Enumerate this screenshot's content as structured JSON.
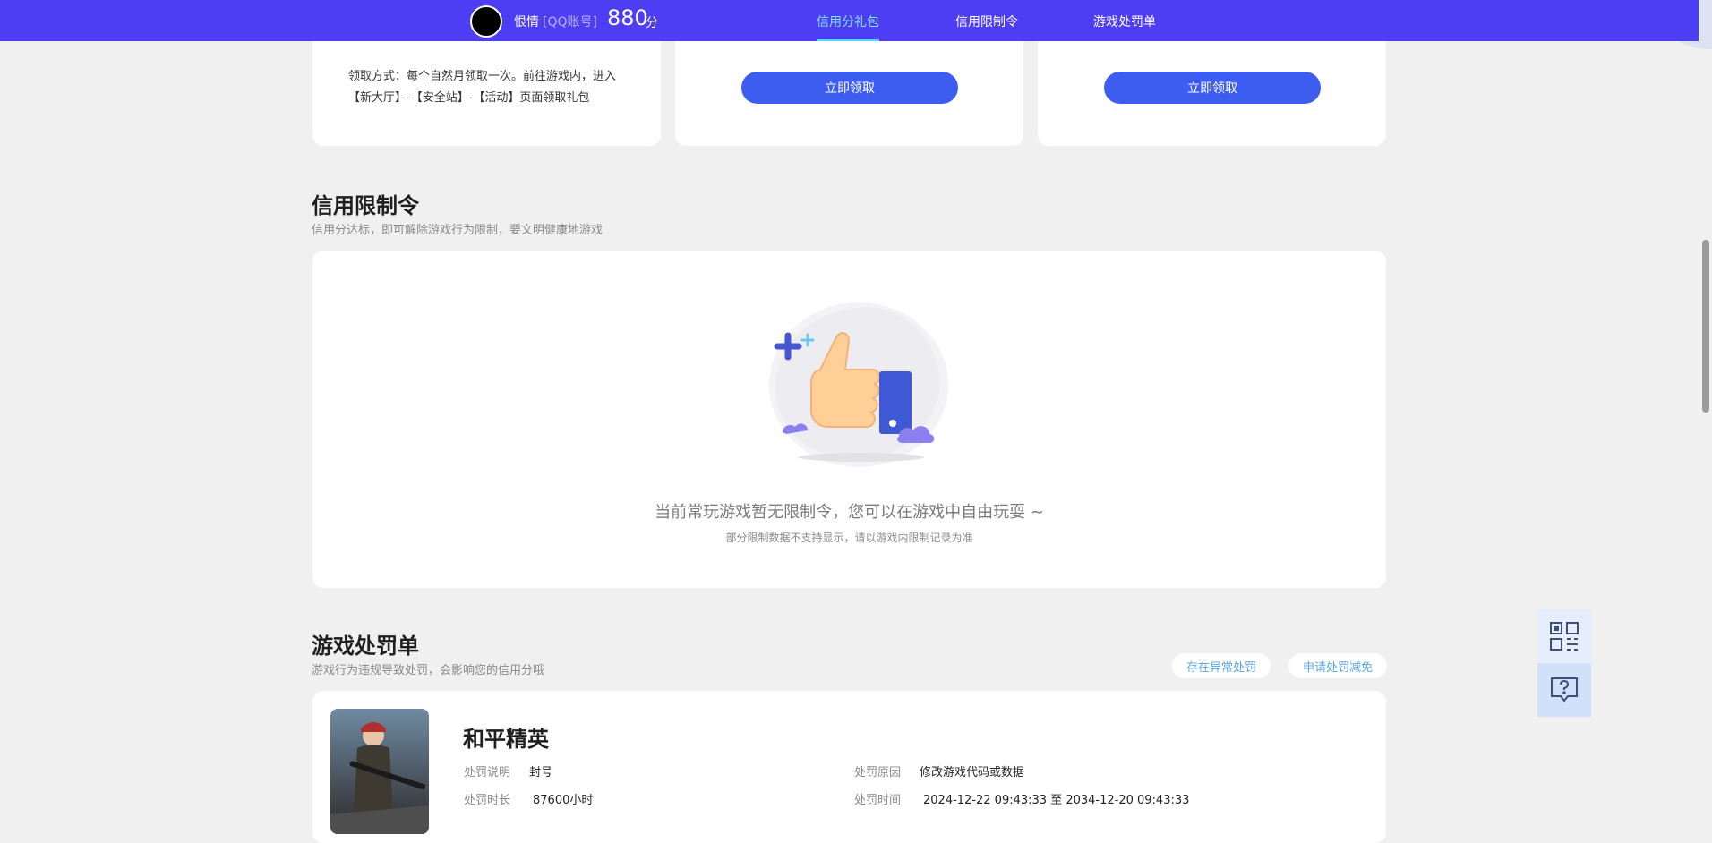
{
  "header": {
    "nickname": "恨情",
    "account_type": "[QQ账号]",
    "score": "880",
    "score_unit": "分",
    "nav": [
      {
        "label": "信用分礼包",
        "active": true
      },
      {
        "label": "信用限制令",
        "active": false
      },
      {
        "label": "游戏处罚单",
        "active": false
      }
    ]
  },
  "gift_cards": {
    "desc": "领取方式：每个自然月领取一次。前往游戏内，进入【新大厅】-【安全站】-【活动】页面领取礼包",
    "claim_label": "立即领取"
  },
  "restriction": {
    "title": "信用限制令",
    "subtitle": "信用分达标，即可解除游戏行为限制，要文明健康地游戏",
    "empty_title": "当前常玩游戏暂无限制令，您可以在游戏中自由玩耍 ~",
    "empty_sub": "部分限制数据不支持显示，请以游戏内限制记录为准"
  },
  "penalty": {
    "title": "游戏处罚单",
    "subtitle": "游戏行为违规导致处罚，会影响您的信用分哦",
    "btn_abnormal": "存在异常处罚",
    "btn_reduce": "申请处罚减免",
    "game_name": "和平精英",
    "rows": {
      "desc_label": "处罚说明",
      "desc_value": "封号",
      "reason_label": "处罚原因",
      "reason_value": "修改游戏代码或数据",
      "duration_label": "处罚时长",
      "duration_value": "87600小时",
      "time_label": "处罚时间",
      "time_value": "2024-12-22 09:43:33 至 2034-12-20 09:43:33"
    }
  },
  "colors": {
    "topbar": "#4d3ef3",
    "accent_blue": "#3d5cf0",
    "active_nav": "#7fe3ff"
  },
  "icons": [
    "qrcode-icon",
    "help-chat-icon",
    "thumbs-up-illustration"
  ]
}
